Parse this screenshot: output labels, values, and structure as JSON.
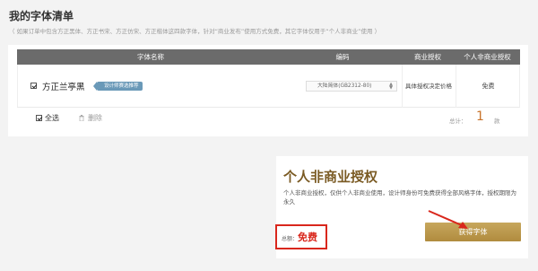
{
  "page": {
    "title": "我的字体清单",
    "note": "（ 如果订单中包含方正黑体、方正书宋、方正仿宋、方正楷体这四款字体，针对“商业发布”使用方式免费，其它字体仅用于“个人非商业”使用 ）"
  },
  "table": {
    "headers": {
      "name": "字体名称",
      "encoding": "编码",
      "business": "商业授权",
      "personal": "个人非商业授权"
    },
    "rows": [
      {
        "font_name": "方正兰亭黑",
        "tag": "设计师赛选推荐",
        "encoding": "大陆简体(GB2312-80)",
        "business_license": "具体授权决定价格",
        "personal_license": "免费"
      }
    ]
  },
  "footer": {
    "select_all": "全选",
    "delete": "删除",
    "total_label": "总计：",
    "total_count": "1",
    "total_unit": "款"
  },
  "auth": {
    "title": "个人非商业授权",
    "description": "个人非商业授权，仅供个人非商业使用，设计师身份可免费获得全部风格字体，授权期限为永久",
    "amount_label": "总额：",
    "amount_value": "免费",
    "button_label": "获得字体"
  },
  "colors": {
    "header_bg": "#6b6b6b",
    "accent_gold": "#b8954a",
    "highlight_red": "#d9271c",
    "count_orange": "#c8732a",
    "tag_blue": "#6a99b8"
  }
}
